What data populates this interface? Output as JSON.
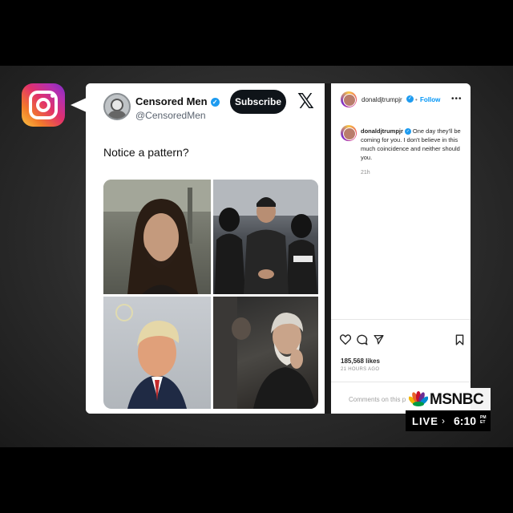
{
  "tweet": {
    "author_name": "Censored Men",
    "verified_mark": "✓",
    "author_handle": "@CensoredMen",
    "subscribe_label": "Subscribe",
    "brand_glyph": "𝕏",
    "text": "Notice a pattern?"
  },
  "instagram_post": {
    "header_username": "donaldjtrumpjr",
    "verified_mark": "✓",
    "separator": "•",
    "follow_label": "Follow",
    "more_label": "•••",
    "caption_username": "donaldjtrumpjr",
    "caption_text": "One day they'll be coming for you. I don't believe in this much coincidence and neither should you.",
    "caption_time": "21h",
    "likes": "185,568 likes",
    "posted_ago": "21 HOURS AGO",
    "comment_placeholder": "Comments on this post"
  },
  "broadcast": {
    "network": "MSNBC",
    "status": "LIVE",
    "chevron": "›",
    "time": "6:10",
    "zone_top": "PM",
    "zone_bottom": "ET"
  },
  "colors": {
    "verified": "#1d9bf0",
    "follow": "#0095f6",
    "ig_gradient_start": "#f9c543",
    "ig_gradient_end": "#7a2dc7"
  },
  "icons": [
    "instagram-logo-icon",
    "x-logo-icon",
    "verified-badge-icon",
    "heart-icon",
    "comment-icon",
    "share-icon",
    "bookmark-icon",
    "peacock-logo-icon"
  ]
}
